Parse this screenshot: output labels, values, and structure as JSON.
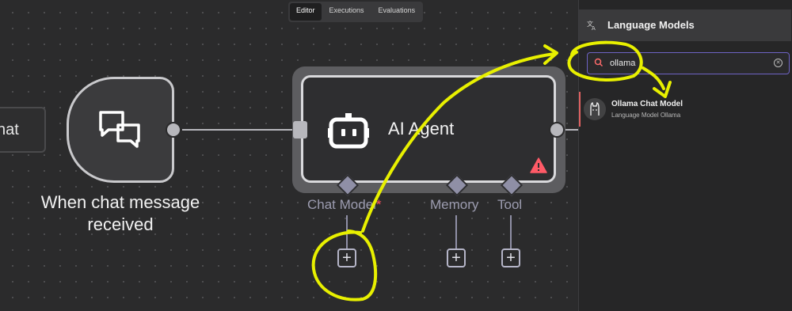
{
  "tabs": [
    {
      "label": "Editor",
      "active": true
    },
    {
      "label": "Executions",
      "active": false
    },
    {
      "label": "Evaluations",
      "active": false
    }
  ],
  "nodes": {
    "chat_stub_label": "hat",
    "trigger_label_line1": "When chat message",
    "trigger_label_line2": "received",
    "agent_title": "AI Agent",
    "sub_nodes": [
      {
        "label": "Chat Model",
        "required_mark": "*"
      },
      {
        "label": "Memory"
      },
      {
        "label": "Tool"
      }
    ],
    "plus_glyph": "+"
  },
  "panel": {
    "title": "Language Models",
    "title_icon": "translate-icon",
    "search_value": "ollama",
    "results": [
      {
        "name": "Ollama Chat Model",
        "description": "Language Model Ollama",
        "icon": "llama-icon"
      }
    ]
  },
  "colors": {
    "annotation": "#e8f000",
    "warning": "#ff5a67",
    "accent": "#6e63c4"
  }
}
